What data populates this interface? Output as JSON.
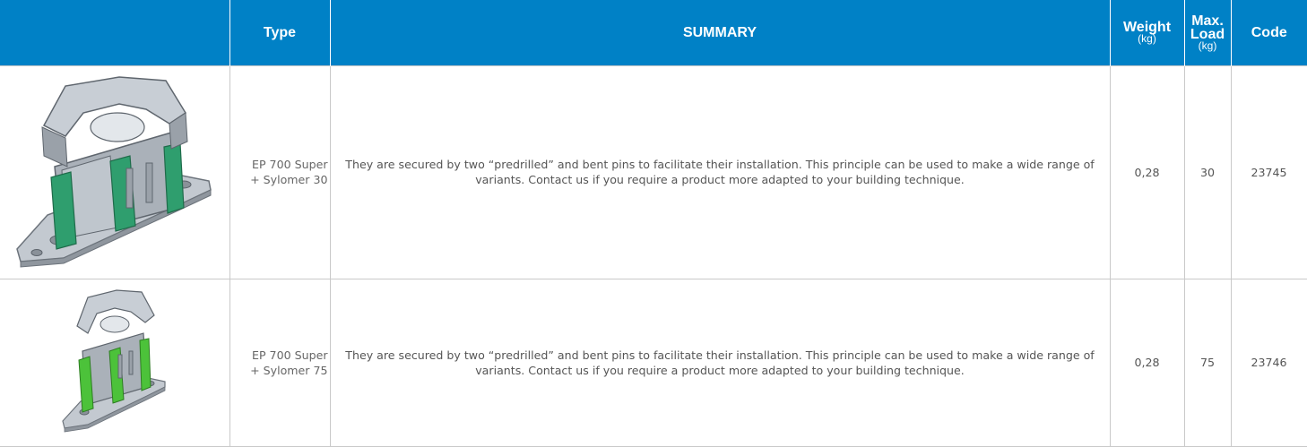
{
  "table": {
    "headers": {
      "image": "",
      "type": "Type",
      "summary": "SUMMARY",
      "weight": "Weight",
      "weight_unit": "(kg)",
      "max": "Max.",
      "load": "Load",
      "load_unit": "(kg)",
      "code": "Code"
    },
    "rows": [
      {
        "type_line1": "EP 700 Super",
        "type_line2": "+ Sylomer 30",
        "summary": "They are secured by two “predrilled” and bent pins to facilitate their installation. This principle can be used to make a wide range of variants. Contact us if you require a product more adapted to your building technique.",
        "weight": "0,28",
        "max_load": "30",
        "code": "23745",
        "image_icon": "ep700-sylomer30-bracket-image"
      },
      {
        "type_line1": "EP 700 Super",
        "type_line2": "+ Sylomer 75",
        "summary": "They are secured by two “predrilled” and bent pins to facilitate their installation. This principle can be used to make a wide range of variants. Contact us if you require a product more adapted to your building technique.",
        "weight": "0,28",
        "max_load": "75",
        "code": "23746",
        "image_icon": "ep700-sylomer75-bracket-image"
      }
    ]
  },
  "colors": {
    "header_bg": "#0081c6",
    "header_text": "#ffffff",
    "border": "#c9c9c9",
    "body_text": "#555555",
    "sylomer_30_green": "#2f9e6e",
    "sylomer_75_green": "#4cc23a",
    "metal_gray": "#b7bec6"
  }
}
